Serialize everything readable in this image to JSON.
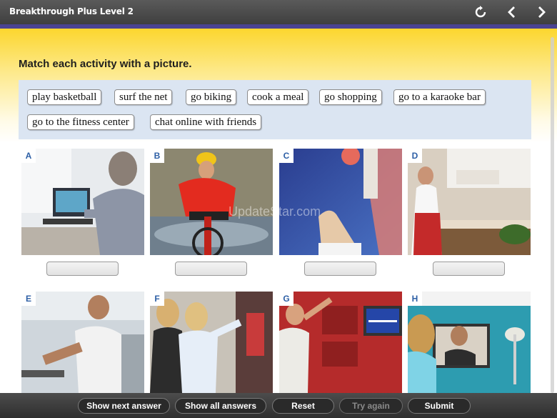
{
  "app": {
    "title": "Breakthrough Plus Level 2"
  },
  "header_icons": [
    "refresh-icon",
    "chevron-left-icon",
    "chevron-right-icon"
  ],
  "colors": {
    "accent_stripe": "#4b4392",
    "letter_blue": "#2d5fa5",
    "banner_yellow": "#fcd62e",
    "wordbank_bg": "#dbe5f2"
  },
  "exercise": {
    "instruction": "Match each activity with a picture.",
    "word_bank": [
      "play basketball",
      "surf the net",
      "go biking",
      "cook a meal",
      "go shopping",
      "go to a karaoke bar",
      "go to the fitness center",
      "chat online with friends"
    ],
    "pictures": [
      {
        "letter": "A",
        "answer": ""
      },
      {
        "letter": "B",
        "answer": ""
      },
      {
        "letter": "C",
        "answer": ""
      },
      {
        "letter": "D",
        "answer": ""
      },
      {
        "letter": "E",
        "answer": ""
      },
      {
        "letter": "F",
        "answer": ""
      },
      {
        "letter": "G",
        "answer": ""
      },
      {
        "letter": "H",
        "answer": ""
      }
    ],
    "watermark": "UpdateStar.com"
  },
  "toolbar": {
    "show_next": "Show next answer",
    "show_all": "Show all answers",
    "reset": "Reset",
    "try_again": "Try again",
    "submit": "Submit"
  }
}
